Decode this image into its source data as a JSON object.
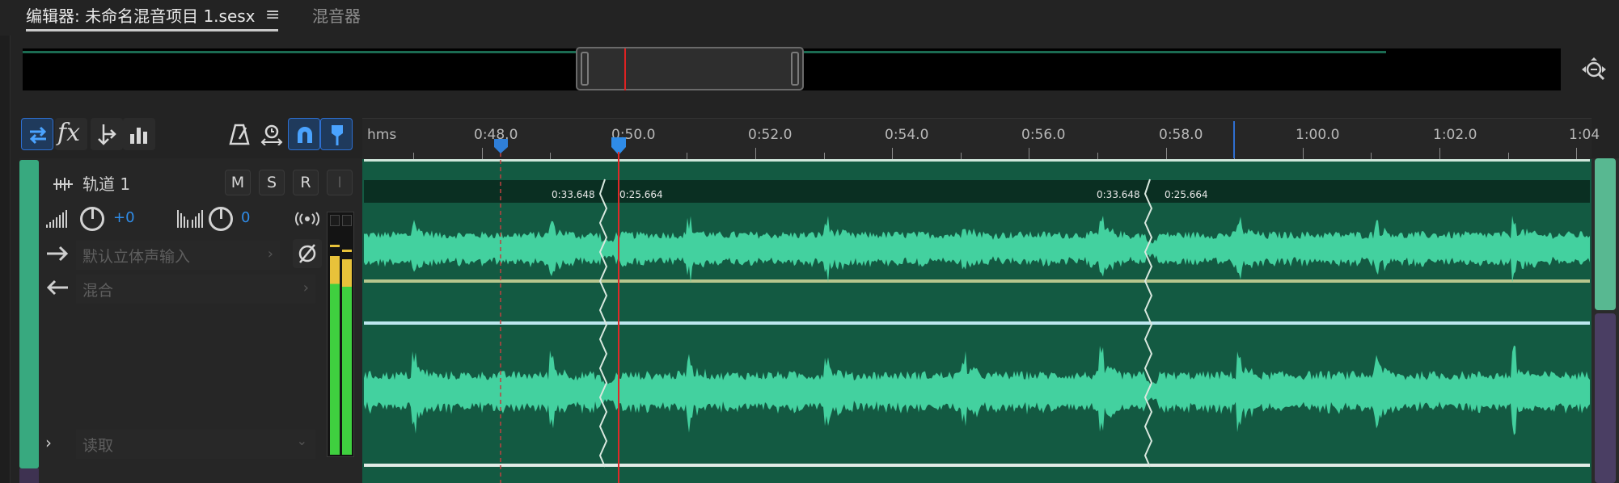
{
  "tabs": {
    "editor_label": "编辑器: 未命名混音项目 1.sesx",
    "menu_glyph": "≡",
    "mixer_label": "混音器"
  },
  "ruler": {
    "unit_label": "hms",
    "times": [
      "0:48.0",
      "0:50.0",
      "0:52.0",
      "0:54.0",
      "0:56.0",
      "0:58.0",
      "1:00.0",
      "1:02.0",
      "1:04"
    ]
  },
  "track": {
    "name": "轨道 1",
    "mute_label": "M",
    "solo_label": "S",
    "record_label": "R",
    "input_monitor_label": "I",
    "volume_value": "+0",
    "pan_value": "0",
    "input_label": "默认立体声输入",
    "output_label": "混合",
    "automation_label": "读取"
  },
  "clips": {
    "labels": [
      "0:33.648",
      "0:25.664",
      "0:33.648",
      "0:25.664"
    ]
  },
  "colors": {
    "accent_blue": "#2f8ce8",
    "track_color": "#38a97f",
    "waveform": "#43d19f",
    "clip_bg": "#135a42",
    "playhead": "#d22222"
  },
  "icons": {
    "toolbar": [
      "loop-icon",
      "fx-icon",
      "send-icon",
      "eq-icon",
      "metronome-icon",
      "time-stretch-icon",
      "snap-magnet-icon",
      "marker-icon"
    ],
    "misc": [
      "zoom-selection-icon",
      "waveform-track-icon",
      "volume-icon",
      "pan-icon",
      "stereo-icon",
      "phase-invert-icon"
    ]
  }
}
